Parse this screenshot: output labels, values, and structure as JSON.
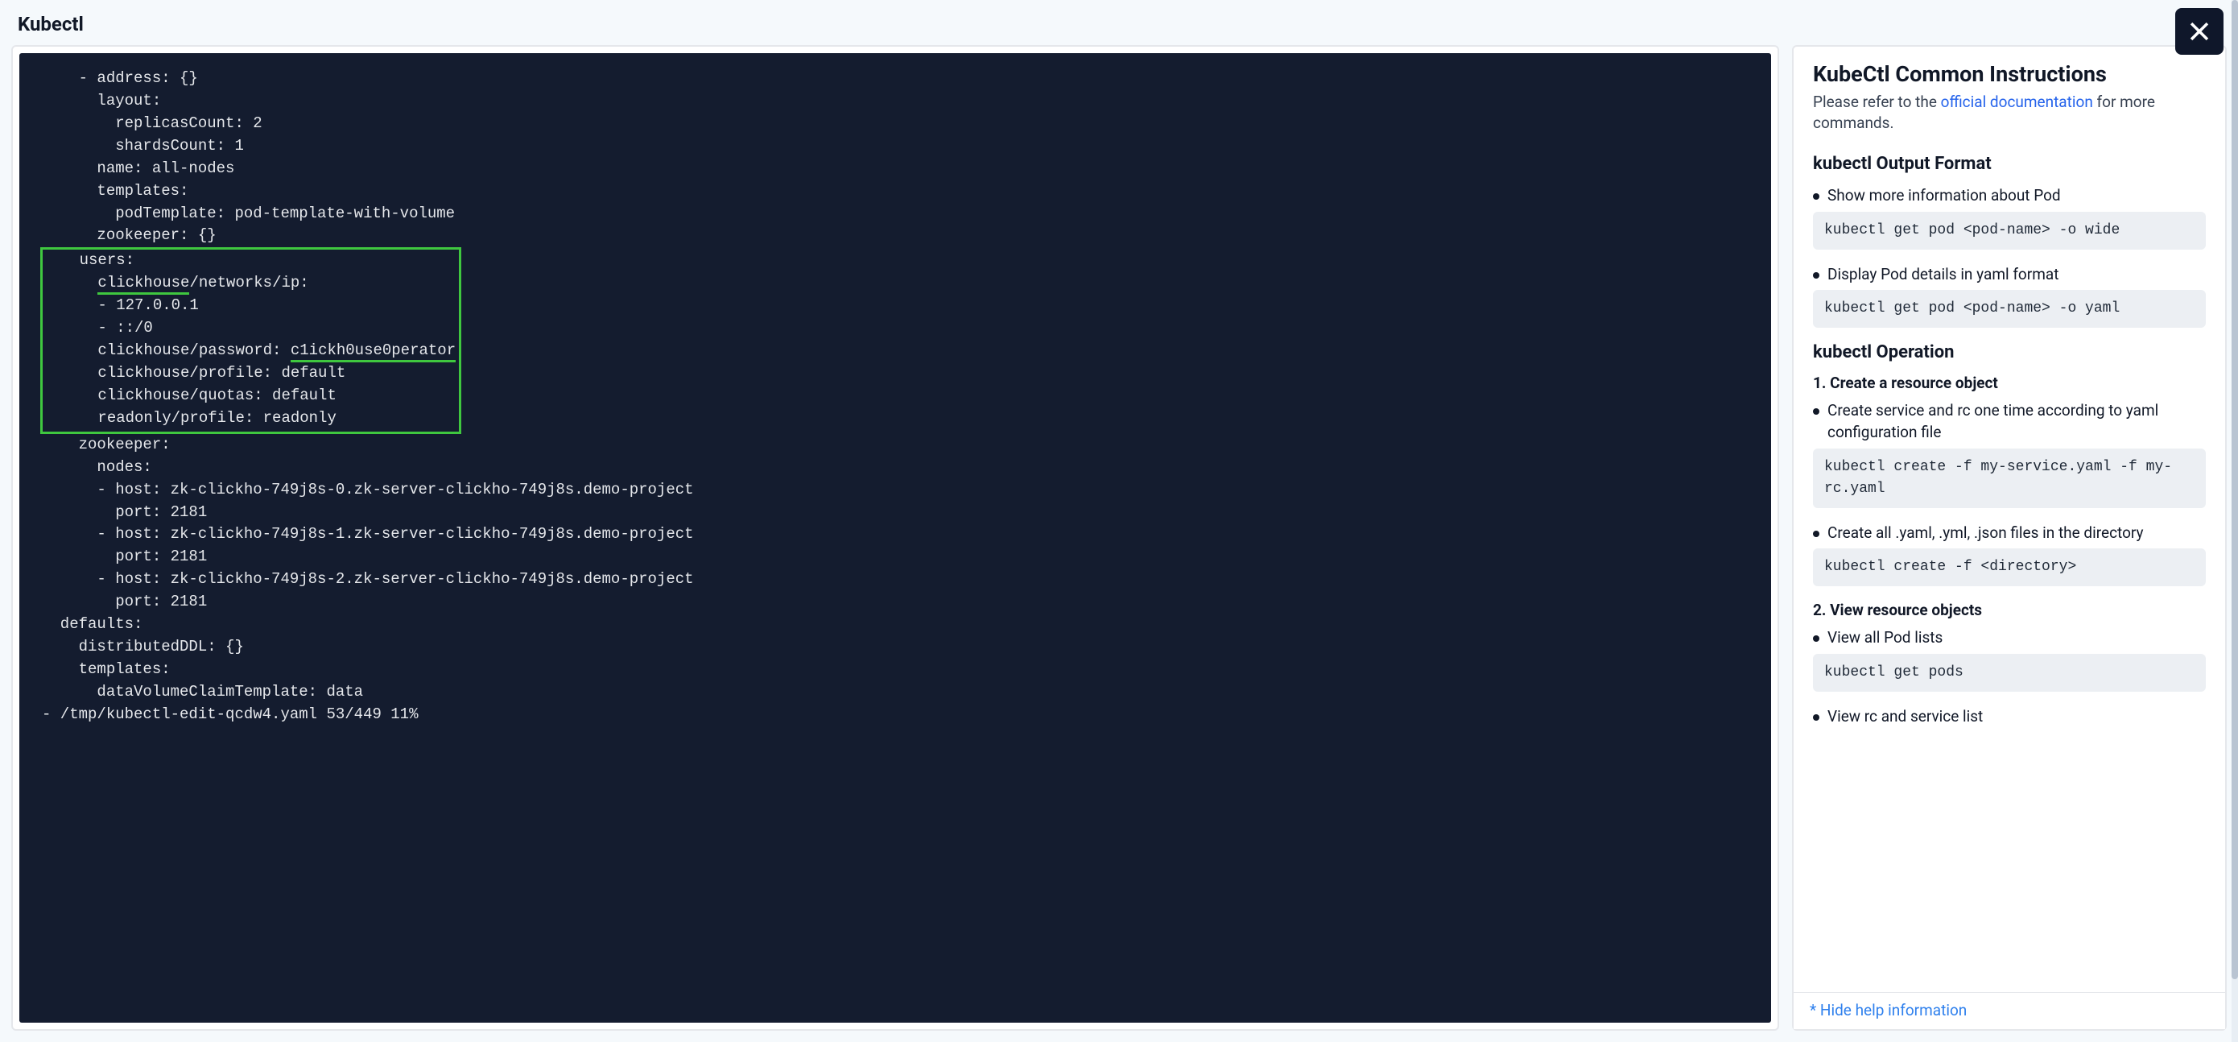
{
  "header": {
    "title": "Kubectl"
  },
  "terminal": {
    "pre_lines": [
      "    - address: {}",
      "      layout:",
      "        replicasCount: 2",
      "        shardsCount: 1",
      "      name: all-nodes",
      "      templates:",
      "        podTemplate: pod-template-with-volume",
      "      zookeeper: {}"
    ],
    "hl": {
      "l1": "    users:",
      "l2_pre": "      ",
      "l2_u": "clickhouse",
      "l2_post": "/networks/ip:",
      "l3": "      - 127.0.0.1",
      "l4": "      - ::/0",
      "l5_pre": "      clickhouse/password: ",
      "l5_u": "c1ickh0use0perator",
      "l6": "      clickhouse/profile: default",
      "l7": "      clickhouse/quotas: default",
      "l8": "      readonly/profile: readonly"
    },
    "post_lines": [
      "    zookeeper:",
      "      nodes:",
      "      - host: zk-clickho-749j8s-0.zk-server-clickho-749j8s.demo-project",
      "        port: 2181",
      "      - host: zk-clickho-749j8s-1.zk-server-clickho-749j8s.demo-project",
      "        port: 2181",
      "      - host: zk-clickho-749j8s-2.zk-server-clickho-749j8s.demo-project",
      "        port: 2181",
      "  defaults:",
      "    distributedDDL: {}",
      "    templates:",
      "      dataVolumeClaimTemplate: data",
      "- /tmp/kubectl-edit-qcdw4.yaml 53/449 11%"
    ]
  },
  "help": {
    "title": "KubeCtl Common Instructions",
    "subtitle_prefix": "Please refer to the ",
    "subtitle_link": "official documentation",
    "subtitle_suffix": " for more commands.",
    "sections": [
      {
        "heading": "kubectl Output Format",
        "items": [
          {
            "text": "Show more information about Pod",
            "cmd": "kubectl get pod <pod-name> -o wide"
          },
          {
            "text": "Display Pod details in yaml format",
            "cmd": "kubectl get pod <pod-name> -o yaml"
          }
        ]
      },
      {
        "heading": "kubectl Operation",
        "groups": [
          {
            "subheading": "1. Create a resource object",
            "items": [
              {
                "text": "Create service and rc one time according to yaml configuration file",
                "cmd": "kubectl create -f my-service.yaml -f my-rc.yaml"
              },
              {
                "text": "Create all .yaml, .yml, .json files in the directory",
                "cmd": "kubectl create -f <directory>"
              }
            ]
          },
          {
            "subheading": "2. View resource objects",
            "items": [
              {
                "text": "View all Pod lists",
                "cmd": "kubectl get pods"
              },
              {
                "text": "View rc and service list",
                "cmd": ""
              }
            ]
          }
        ]
      }
    ],
    "footer": "* Hide help information"
  }
}
